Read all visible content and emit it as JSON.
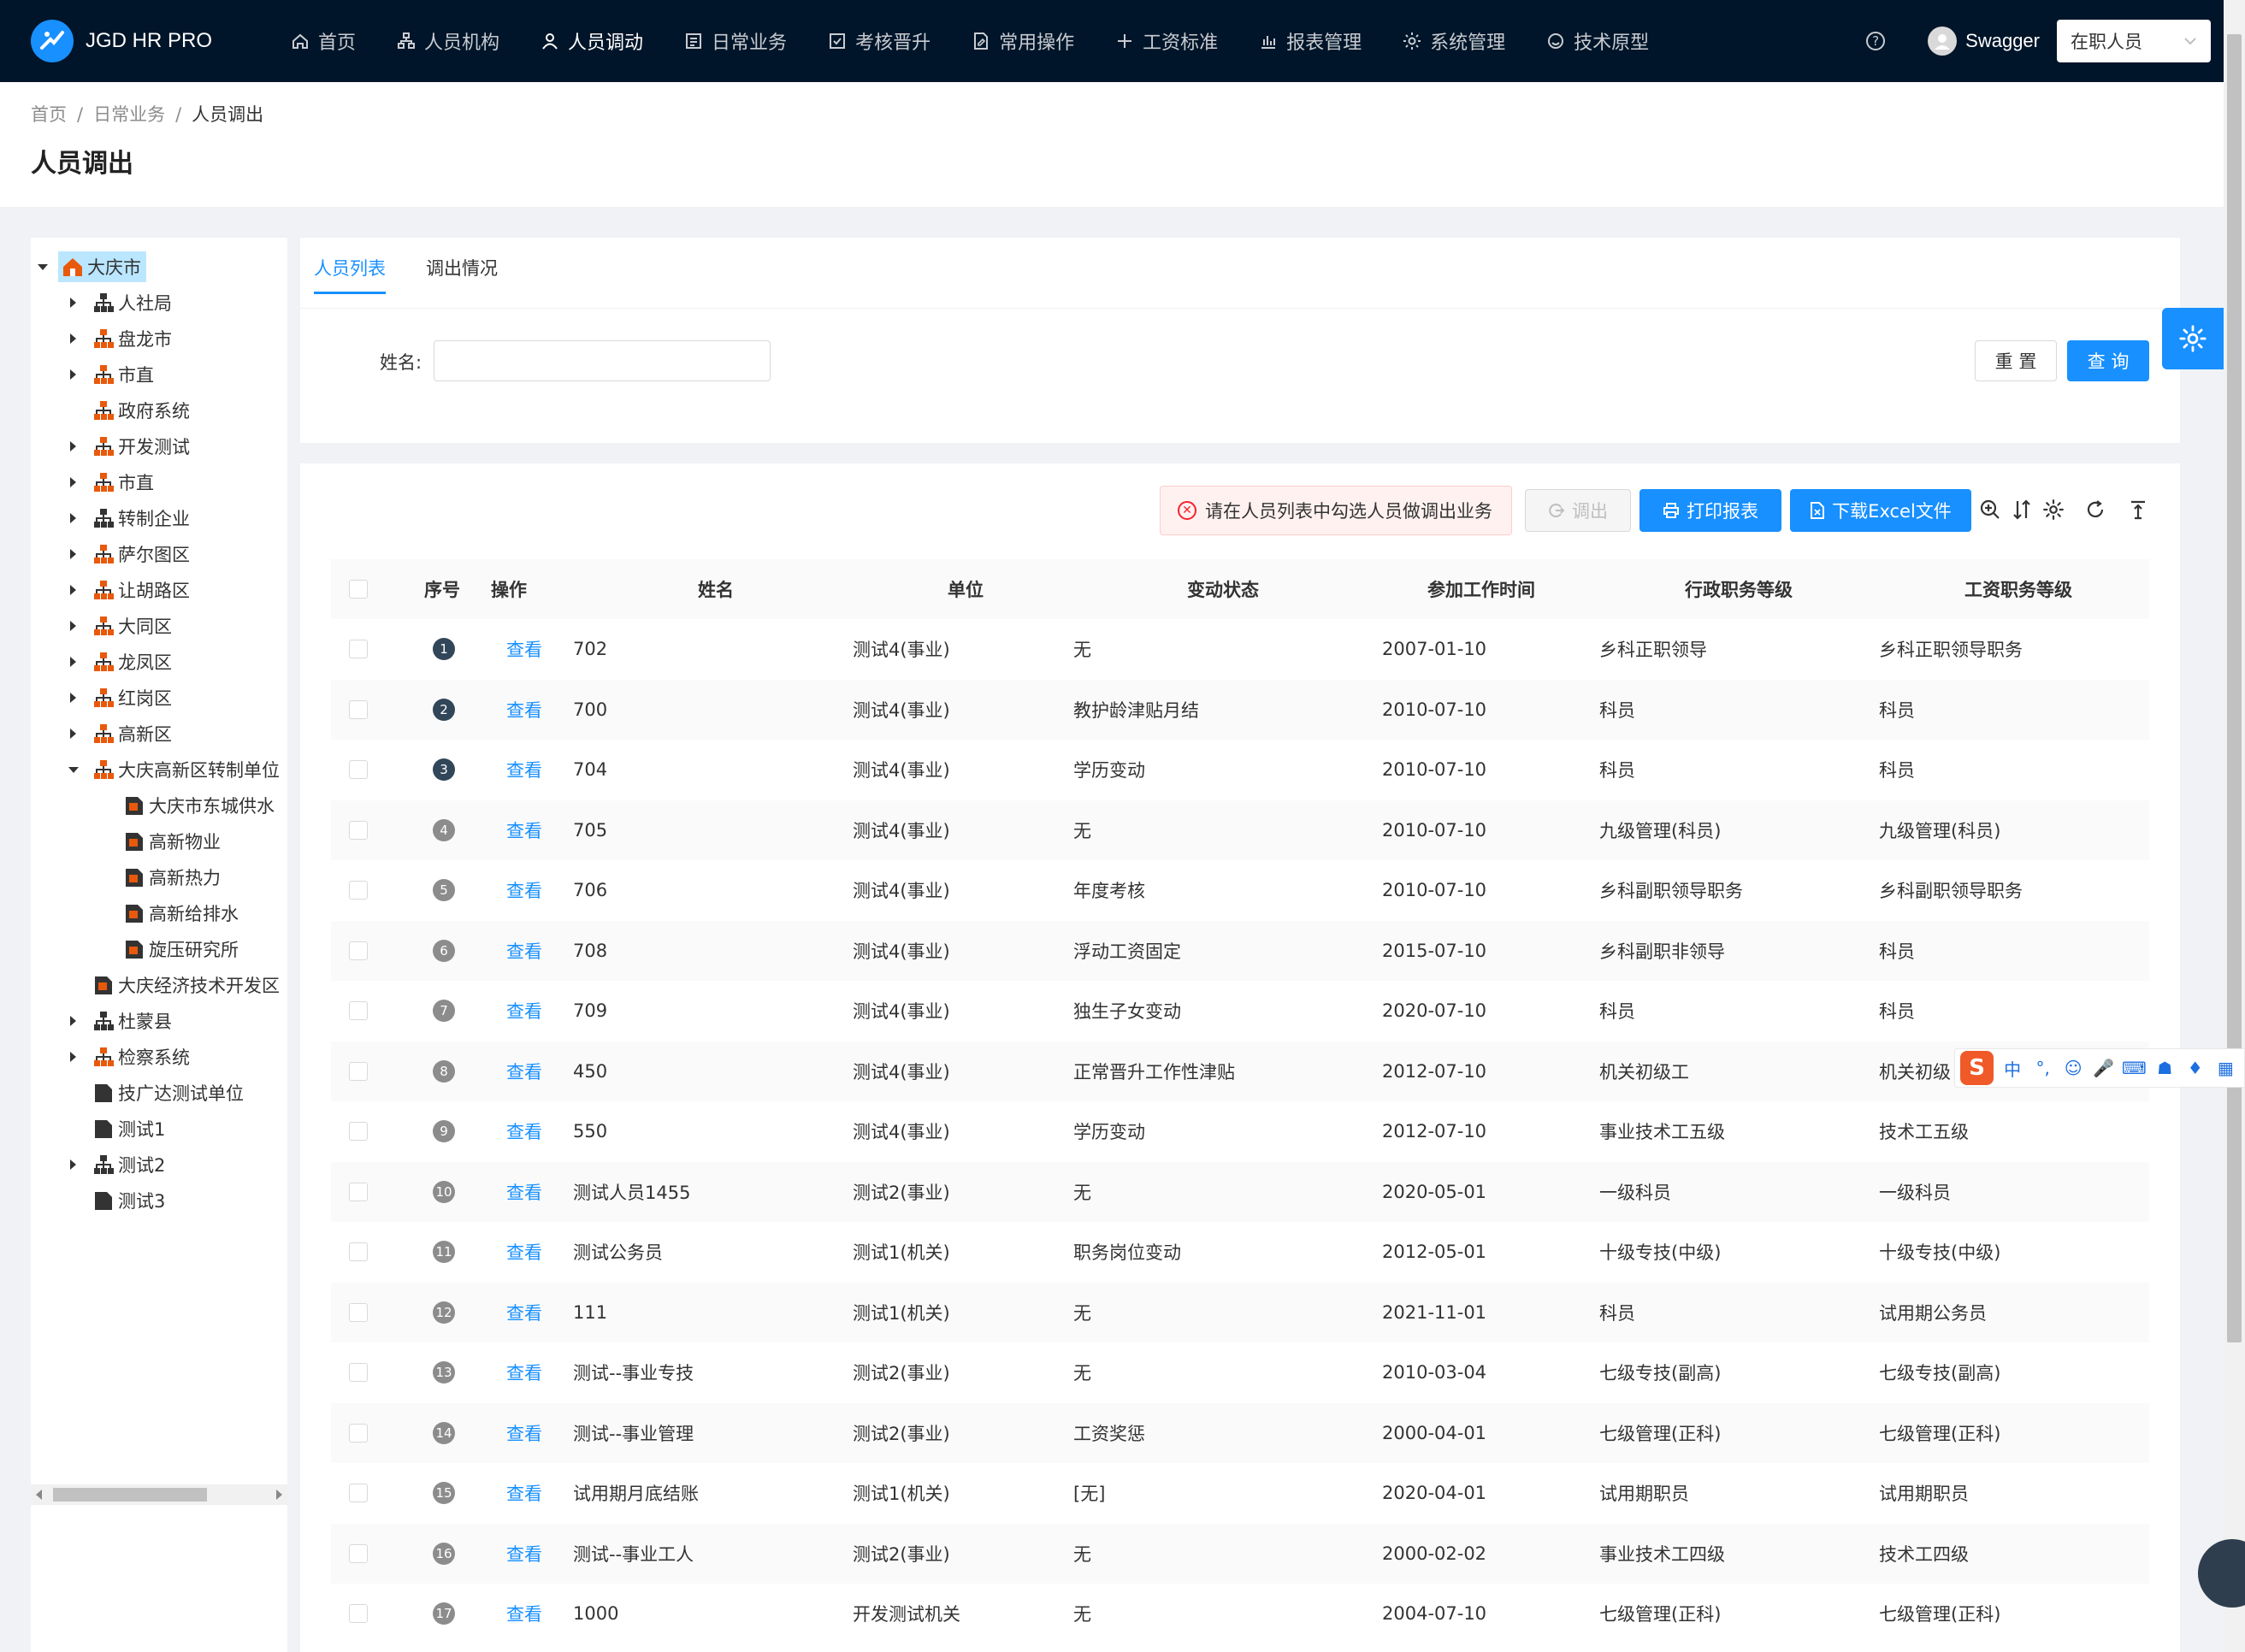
{
  "header": {
    "app_name": "JGD HR PRO",
    "nav": [
      {
        "label": "首页",
        "icon": "home-icon"
      },
      {
        "label": "人员机构",
        "icon": "org-icon"
      },
      {
        "label": "人员调动",
        "icon": "person-icon"
      },
      {
        "label": "日常业务",
        "icon": "document-icon"
      },
      {
        "label": "考核晋升",
        "icon": "check-square-icon"
      },
      {
        "label": "常用操作",
        "icon": "file-edit-icon"
      },
      {
        "label": "工资标准",
        "icon": "plus-icon"
      },
      {
        "label": "报表管理",
        "icon": "bar-chart-icon"
      },
      {
        "label": "系统管理",
        "icon": "gear-icon"
      },
      {
        "label": "技术原型",
        "icon": "smile-icon"
      }
    ],
    "active_nav": "人员调动",
    "user": "Swagger",
    "status_select": "在职人员"
  },
  "breadcrumb": [
    "首页",
    "日常业务",
    "人员调出"
  ],
  "page_title": "人员调出",
  "tree": [
    {
      "label": "大庆市",
      "level": 0,
      "toggle": "down",
      "icon": "home-org-icon",
      "selected": true
    },
    {
      "label": "人社局",
      "level": 1,
      "toggle": "right",
      "icon": "org-chart-icon"
    },
    {
      "label": "盘龙市",
      "level": 1,
      "toggle": "right",
      "icon": "org-chart-orange-icon"
    },
    {
      "label": "市直",
      "level": 1,
      "toggle": "right",
      "icon": "org-chart-orange-icon"
    },
    {
      "label": "政府系统",
      "level": 1,
      "toggle": "none",
      "icon": "org-chart-orange-icon"
    },
    {
      "label": "开发测试",
      "level": 1,
      "toggle": "right",
      "icon": "org-chart-orange-icon"
    },
    {
      "label": "市直",
      "level": 1,
      "toggle": "right",
      "icon": "org-chart-orange-icon"
    },
    {
      "label": "转制企业",
      "level": 1,
      "toggle": "right",
      "icon": "org-chart-icon"
    },
    {
      "label": "萨尔图区",
      "level": 1,
      "toggle": "right",
      "icon": "org-chart-orange-icon"
    },
    {
      "label": "让胡路区",
      "level": 1,
      "toggle": "right",
      "icon": "org-chart-orange-icon"
    },
    {
      "label": "大同区",
      "level": 1,
      "toggle": "right",
      "icon": "org-chart-orange-icon"
    },
    {
      "label": "龙凤区",
      "level": 1,
      "toggle": "right",
      "icon": "org-chart-orange-icon"
    },
    {
      "label": "红岗区",
      "level": 1,
      "toggle": "right",
      "icon": "org-chart-orange-icon"
    },
    {
      "label": "高新区",
      "level": 1,
      "toggle": "right",
      "icon": "org-chart-orange-icon"
    },
    {
      "label": "大庆高新区转制单位",
      "level": 1,
      "toggle": "down",
      "icon": "org-chart-orange-icon"
    },
    {
      "label": "大庆市东城供水",
      "level": 2,
      "toggle": "none",
      "icon": "unit-orange-icon"
    },
    {
      "label": "高新物业",
      "level": 2,
      "toggle": "none",
      "icon": "unit-orange-icon"
    },
    {
      "label": "高新热力",
      "level": 2,
      "toggle": "none",
      "icon": "unit-orange-icon"
    },
    {
      "label": "高新给排水",
      "level": 2,
      "toggle": "none",
      "icon": "unit-orange-icon"
    },
    {
      "label": "旋压研究所",
      "level": 2,
      "toggle": "none",
      "icon": "unit-orange-icon"
    },
    {
      "label": "大庆经济技术开发区",
      "level": 1,
      "toggle": "none",
      "icon": "unit-orange-icon"
    },
    {
      "label": "杜蒙县",
      "level": 1,
      "toggle": "right",
      "icon": "org-chart-icon"
    },
    {
      "label": "检察系统",
      "level": 1,
      "toggle": "right",
      "icon": "org-chart-orange-icon"
    },
    {
      "label": "技广达测试单位",
      "level": 1,
      "toggle": "none",
      "icon": "unit-dark-icon"
    },
    {
      "label": "测试1",
      "level": 1,
      "toggle": "none",
      "icon": "unit-dark-icon"
    },
    {
      "label": "测试2",
      "level": 1,
      "toggle": "right",
      "icon": "org-chart-icon"
    },
    {
      "label": "测试3",
      "level": 1,
      "toggle": "none",
      "icon": "unit-dark-icon"
    }
  ],
  "tabs": [
    "人员列表",
    "调出情况"
  ],
  "active_tab": "人员列表",
  "search": {
    "name_label": "姓名:",
    "name_value": "",
    "reset_label": "重 置",
    "query_label": "查 询"
  },
  "toolbar": {
    "alert_text": "请在人员列表中勾选人员做调出业务",
    "transfer_label": "调出",
    "print_label": "打印报表",
    "excel_label": "下载Excel文件"
  },
  "table": {
    "columns": [
      "序号",
      "操作",
      "姓名",
      "单位",
      "变动状态",
      "参加工作时间",
      "行政职务等级",
      "工资职务等级"
    ],
    "action_label": "查看",
    "rows": [
      {
        "no": "1",
        "name": "702",
        "unit": "测试4(事业)",
        "change": "无",
        "date": "2007-01-10",
        "admin": "乡科正职领导",
        "salary": "乡科正职领导职务"
      },
      {
        "no": "2",
        "name": "700",
        "unit": "测试4(事业)",
        "change": "教护龄津贴月结",
        "date": "2010-07-10",
        "admin": "科员",
        "salary": "科员"
      },
      {
        "no": "3",
        "name": "704",
        "unit": "测试4(事业)",
        "change": "学历变动",
        "date": "2010-07-10",
        "admin": "科员",
        "salary": "科员"
      },
      {
        "no": "4",
        "name": "705",
        "unit": "测试4(事业)",
        "change": "无",
        "date": "2010-07-10",
        "admin": "九级管理(科员)",
        "salary": "九级管理(科员)"
      },
      {
        "no": "5",
        "name": "706",
        "unit": "测试4(事业)",
        "change": "年度考核",
        "date": "2010-07-10",
        "admin": "乡科副职领导职务",
        "salary": "乡科副职领导职务"
      },
      {
        "no": "6",
        "name": "708",
        "unit": "测试4(事业)",
        "change": "浮动工资固定",
        "date": "2015-07-10",
        "admin": "乡科副职非领导",
        "salary": "科员"
      },
      {
        "no": "7",
        "name": "709",
        "unit": "测试4(事业)",
        "change": "独生子女变动",
        "date": "2020-07-10",
        "admin": "科员",
        "salary": "科员"
      },
      {
        "no": "8",
        "name": "450",
        "unit": "测试4(事业)",
        "change": "正常晋升工作性津贴",
        "date": "2012-07-10",
        "admin": "机关初级工",
        "salary": "机关初级"
      },
      {
        "no": "9",
        "name": "550",
        "unit": "测试4(事业)",
        "change": "学历变动",
        "date": "2012-07-10",
        "admin": "事业技术工五级",
        "salary": "技术工五级"
      },
      {
        "no": "10",
        "name": "测试人员1455",
        "unit": "测试2(事业)",
        "change": "无",
        "date": "2020-05-01",
        "admin": "一级科员",
        "salary": "一级科员"
      },
      {
        "no": "11",
        "name": "测试公务员",
        "unit": "测试1(机关)",
        "change": "职务岗位变动",
        "date": "2012-05-01",
        "admin": "十级专技(中级)",
        "salary": "十级专技(中级)"
      },
      {
        "no": "12",
        "name": "111",
        "unit": "测试1(机关)",
        "change": "无",
        "date": "2021-11-01",
        "admin": "科员",
        "salary": "试用期公务员"
      },
      {
        "no": "13",
        "name": "测试--事业专技",
        "unit": "测试2(事业)",
        "change": "无",
        "date": "2010-03-04",
        "admin": "七级专技(副高)",
        "salary": "七级专技(副高)"
      },
      {
        "no": "14",
        "name": "测试--事业管理",
        "unit": "测试2(事业)",
        "change": "工资奖惩",
        "date": "2000-04-01",
        "admin": "七级管理(正科)",
        "salary": "七级管理(正科)"
      },
      {
        "no": "15",
        "name": "试用期月底结账",
        "unit": "测试1(机关)",
        "change": "[无]",
        "date": "2020-04-01",
        "admin": "试用期职员",
        "salary": "试用期职员"
      },
      {
        "no": "16",
        "name": "测试--事业工人",
        "unit": "测试2(事业)",
        "change": "无",
        "date": "2000-02-02",
        "admin": "事业技术工四级",
        "salary": "技术工四级"
      },
      {
        "no": "17",
        "name": "1000",
        "unit": "开发测试机关",
        "change": "无",
        "date": "2004-07-10",
        "admin": "七级管理(正科)",
        "salary": "七级管理(正科)"
      }
    ]
  },
  "ime": {
    "logo": "S",
    "mode": "中"
  },
  "colors": {
    "header_bg": "#001529",
    "primary": "#1890ff",
    "alert_bg": "#fff1f0",
    "alert_icon": "#f5222d",
    "tree_org_orange": "#e8590c",
    "tree_selected": "#bae7ff"
  }
}
